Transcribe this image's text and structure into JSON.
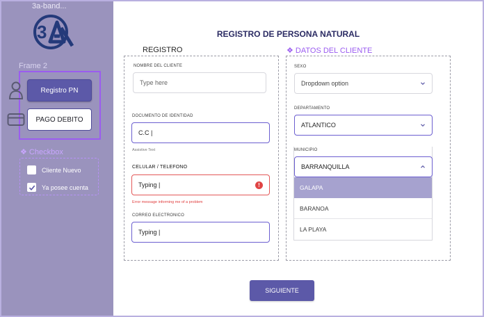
{
  "sidebar": {
    "frame_name": "3a-band...",
    "frame2_label": "Frame 2",
    "buttons": {
      "registro": "Registro PN",
      "pago": "PAGO DEBITO"
    },
    "checkbox_title": "❖ Checkbox",
    "checkboxes": [
      {
        "label": "Cliente Nuevo",
        "checked": false
      },
      {
        "label": "Ya posee cuenta",
        "checked": true
      }
    ]
  },
  "page_title": "REGISTRO DE PERSONA NATURAL",
  "registro": {
    "section_label": "REGISTRO",
    "nombre": {
      "label": "NOMBRE DEL CLIENTE",
      "placeholder": "Type here"
    },
    "documento": {
      "label": "DOCUMENTO DE IDENTIDAD",
      "value": "C.C |",
      "helper": "Assistive Text"
    },
    "celular": {
      "label": "CELULAR / TELEFONO",
      "value": "Typing |",
      "error": "Error message informing me of a problem"
    },
    "correo": {
      "label": "CORREO ELECTRONICO",
      "value": "Typing |"
    }
  },
  "datos": {
    "section_label": "❖ DATOS DEL CLIENTE",
    "sexo": {
      "label": "SEXO",
      "value": "Dropdown option"
    },
    "departamento": {
      "label": "DEPARTAMENTO",
      "value": "ATLANTICO"
    },
    "municipio": {
      "label": "MUNICIPIO",
      "value": "BARRANQUILLA",
      "options": [
        "GALAPA",
        "BARANOA",
        "LA PLAYA"
      ],
      "selected_option": "GALAPA"
    }
  },
  "siguiente_button": "SIGUIENTE",
  "colors": {
    "sidebar": "#9a93bd",
    "primary": "#5c59a8",
    "accent": "#9b5cf0",
    "error": "#e04040"
  }
}
